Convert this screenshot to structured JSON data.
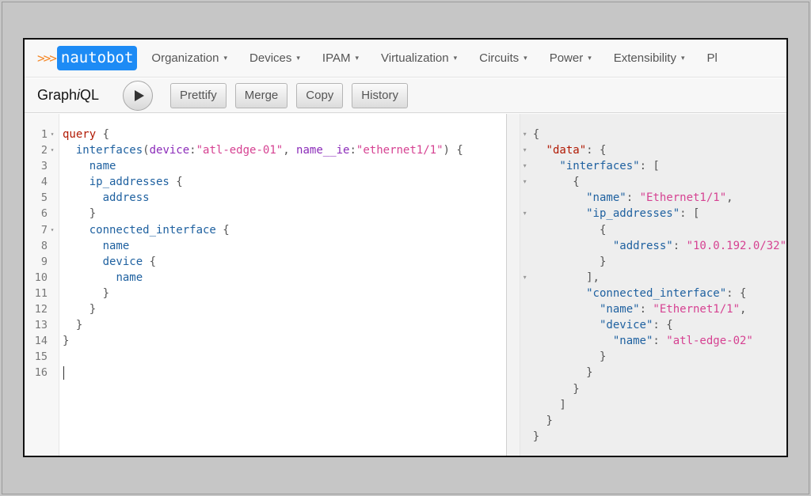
{
  "brand": {
    "arrows": ">>>",
    "name": "nautobot"
  },
  "nav": [
    {
      "label": "Organization"
    },
    {
      "label": "Devices"
    },
    {
      "label": "IPAM"
    },
    {
      "label": "Virtualization"
    },
    {
      "label": "Circuits"
    },
    {
      "label": "Power"
    },
    {
      "label": "Extensibility"
    },
    {
      "label": "Pl"
    }
  ],
  "toolbar": {
    "title_prefix": "Graph",
    "title_italic": "i",
    "title_suffix": "QL",
    "prettify": "Prettify",
    "merge": "Merge",
    "copy": "Copy",
    "history": "History"
  },
  "query": {
    "line_numbers": [
      "1",
      "2",
      "3",
      "4",
      "5",
      "6",
      "7",
      "8",
      "9",
      "10",
      "11",
      "12",
      "13",
      "14",
      "15",
      "16"
    ],
    "lines": [
      {
        "indent": "",
        "tokens": [
          {
            "t": "kw",
            "v": "query"
          },
          {
            "t": "pn",
            "v": " {"
          }
        ]
      },
      {
        "indent": "  ",
        "tokens": [
          {
            "t": "fld",
            "v": "interfaces"
          },
          {
            "t": "pn",
            "v": "("
          },
          {
            "t": "arg",
            "v": "device"
          },
          {
            "t": "pn",
            "v": ":"
          },
          {
            "t": "str",
            "v": "\"atl-edge-01\""
          },
          {
            "t": "pn",
            "v": ", "
          },
          {
            "t": "arg",
            "v": "name__ie"
          },
          {
            "t": "pn",
            "v": ":"
          },
          {
            "t": "str",
            "v": "\"ethernet1/1\""
          },
          {
            "t": "pn",
            "v": ") {"
          }
        ]
      },
      {
        "indent": "    ",
        "tokens": [
          {
            "t": "fld",
            "v": "name"
          }
        ]
      },
      {
        "indent": "    ",
        "tokens": [
          {
            "t": "fld",
            "v": "ip_addresses"
          },
          {
            "t": "pn",
            "v": " {"
          }
        ]
      },
      {
        "indent": "      ",
        "tokens": [
          {
            "t": "fld",
            "v": "address"
          }
        ]
      },
      {
        "indent": "    ",
        "tokens": [
          {
            "t": "pn",
            "v": "}"
          }
        ]
      },
      {
        "indent": "    ",
        "tokens": [
          {
            "t": "fld",
            "v": "connected_interface"
          },
          {
            "t": "pn",
            "v": " {"
          }
        ]
      },
      {
        "indent": "      ",
        "tokens": [
          {
            "t": "fld",
            "v": "name"
          }
        ]
      },
      {
        "indent": "      ",
        "tokens": [
          {
            "t": "fld",
            "v": "device"
          },
          {
            "t": "pn",
            "v": " {"
          }
        ]
      },
      {
        "indent": "        ",
        "tokens": [
          {
            "t": "fld",
            "v": "name"
          }
        ]
      },
      {
        "indent": "      ",
        "tokens": [
          {
            "t": "pn",
            "v": "}"
          }
        ]
      },
      {
        "indent": "    ",
        "tokens": [
          {
            "t": "pn",
            "v": "}"
          }
        ]
      },
      {
        "indent": "  ",
        "tokens": [
          {
            "t": "pn",
            "v": "}"
          }
        ]
      },
      {
        "indent": "",
        "tokens": [
          {
            "t": "pn",
            "v": "}"
          }
        ]
      },
      {
        "indent": "",
        "tokens": []
      },
      {
        "indent": "",
        "tokens": [],
        "cursor": true
      }
    ],
    "fold_lines": [
      1,
      2,
      7
    ]
  },
  "result": {
    "fold_lines": [
      1,
      2,
      3,
      4,
      6,
      10
    ],
    "lines": [
      {
        "indent": "",
        "tokens": [
          {
            "t": "pn",
            "v": "{"
          }
        ]
      },
      {
        "indent": "  ",
        "tokens": [
          {
            "t": "rkey-top",
            "v": "\"data\""
          },
          {
            "t": "pn",
            "v": ": {"
          }
        ]
      },
      {
        "indent": "    ",
        "tokens": [
          {
            "t": "rkey",
            "v": "\"interfaces\""
          },
          {
            "t": "pn",
            "v": ": ["
          }
        ]
      },
      {
        "indent": "      ",
        "tokens": [
          {
            "t": "pn",
            "v": "{"
          }
        ]
      },
      {
        "indent": "        ",
        "tokens": [
          {
            "t": "rkey",
            "v": "\"name\""
          },
          {
            "t": "pn",
            "v": ": "
          },
          {
            "t": "rstr",
            "v": "\"Ethernet1/1\""
          },
          {
            "t": "pn",
            "v": ","
          }
        ]
      },
      {
        "indent": "        ",
        "tokens": [
          {
            "t": "rkey",
            "v": "\"ip_addresses\""
          },
          {
            "t": "pn",
            "v": ": ["
          }
        ]
      },
      {
        "indent": "          ",
        "tokens": [
          {
            "t": "pn",
            "v": "{"
          }
        ]
      },
      {
        "indent": "            ",
        "tokens": [
          {
            "t": "rkey",
            "v": "\"address\""
          },
          {
            "t": "pn",
            "v": ": "
          },
          {
            "t": "rstr",
            "v": "\"10.0.192.0/32\""
          }
        ]
      },
      {
        "indent": "          ",
        "tokens": [
          {
            "t": "pn",
            "v": "}"
          }
        ]
      },
      {
        "indent": "        ",
        "tokens": [
          {
            "t": "pn",
            "v": "],"
          }
        ]
      },
      {
        "indent": "        ",
        "tokens": [
          {
            "t": "rkey",
            "v": "\"connected_interface\""
          },
          {
            "t": "pn",
            "v": ": {"
          }
        ]
      },
      {
        "indent": "          ",
        "tokens": [
          {
            "t": "rkey",
            "v": "\"name\""
          },
          {
            "t": "pn",
            "v": ": "
          },
          {
            "t": "rstr",
            "v": "\"Ethernet1/1\""
          },
          {
            "t": "pn",
            "v": ","
          }
        ]
      },
      {
        "indent": "          ",
        "tokens": [
          {
            "t": "rkey",
            "v": "\"device\""
          },
          {
            "t": "pn",
            "v": ": {"
          }
        ]
      },
      {
        "indent": "            ",
        "tokens": [
          {
            "t": "rkey",
            "v": "\"name\""
          },
          {
            "t": "pn",
            "v": ": "
          },
          {
            "t": "rstr",
            "v": "\"atl-edge-02\""
          }
        ]
      },
      {
        "indent": "          ",
        "tokens": [
          {
            "t": "pn",
            "v": "}"
          }
        ]
      },
      {
        "indent": "        ",
        "tokens": [
          {
            "t": "pn",
            "v": "}"
          }
        ]
      },
      {
        "indent": "      ",
        "tokens": [
          {
            "t": "pn",
            "v": "}"
          }
        ]
      },
      {
        "indent": "    ",
        "tokens": [
          {
            "t": "pn",
            "v": "]"
          }
        ]
      },
      {
        "indent": "  ",
        "tokens": [
          {
            "t": "pn",
            "v": "}"
          }
        ]
      },
      {
        "indent": "",
        "tokens": [
          {
            "t": "pn",
            "v": "}"
          }
        ]
      }
    ]
  },
  "icons": {
    "run": "play-icon",
    "fold": "fold-arrow-icon",
    "caret": "chevron-down-icon"
  },
  "colors": {
    "brand": "#1d8bf5",
    "arrows": "#f5892a",
    "keyword": "#b11a04",
    "field": "#1f61a0",
    "argument": "#8b2bb9",
    "string": "#d64292"
  }
}
